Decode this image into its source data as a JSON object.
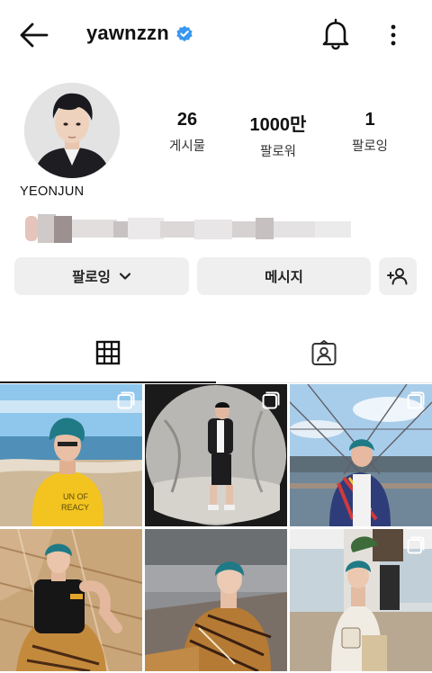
{
  "header": {
    "username": "yawnzzn",
    "back_icon": "arrow-left-icon",
    "verified_icon": "verified-badge-icon",
    "notification_icon": "bell-icon",
    "more_icon": "more-vertical-icon"
  },
  "profile": {
    "display_name": "YEONJUN",
    "stats": [
      {
        "value": "26",
        "label": "게시물"
      },
      {
        "value": "1000만",
        "label": "팔로워"
      },
      {
        "value": "1",
        "label": "팔로잉"
      }
    ]
  },
  "actions": {
    "following_label": "팔로잉",
    "message_label": "메시지",
    "dropdown_icon": "chevron-down-icon",
    "suggest_icon": "add-person-icon"
  },
  "tabs": [
    {
      "icon": "grid-icon",
      "active": true
    },
    {
      "icon": "tagged-person-icon",
      "active": false
    }
  ],
  "posts": [
    {
      "multiple": true
    },
    {
      "multiple": true
    },
    {
      "multiple": true
    },
    {
      "multiple": false
    },
    {
      "multiple": false
    },
    {
      "multiple": true
    }
  ],
  "colors": {
    "accent_verified": "#3897f0",
    "button_bg": "#efefef",
    "text_primary": "#111111"
  }
}
